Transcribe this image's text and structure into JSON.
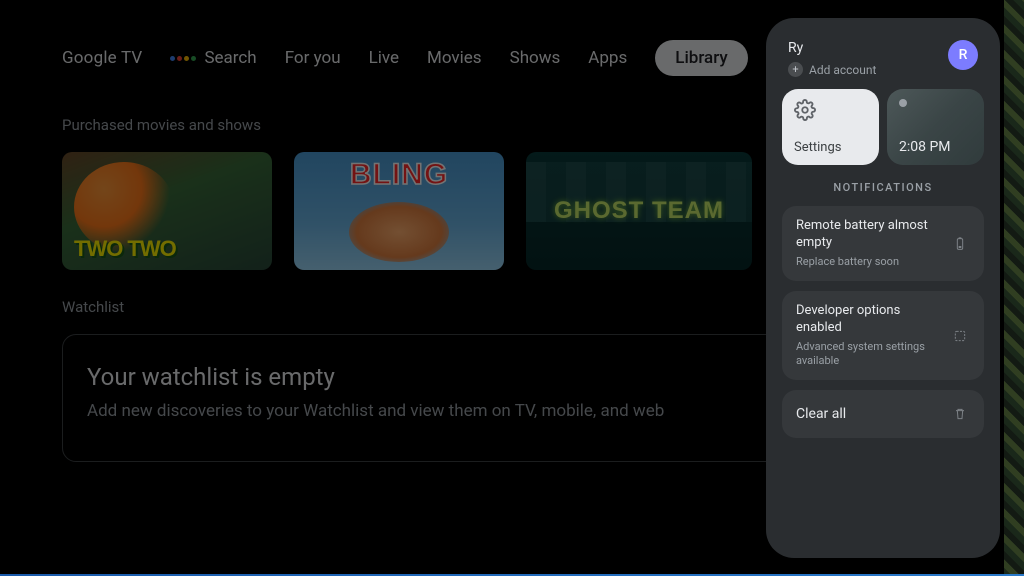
{
  "logo": "Google TV",
  "nav": {
    "search": "Search",
    "foryou": "For you",
    "live": "Live",
    "movies": "Movies",
    "shows": "Shows",
    "apps": "Apps",
    "library": "Library"
  },
  "sections": {
    "purchased": "Purchased movies and shows",
    "watchlist": "Watchlist"
  },
  "posters": {
    "p1": "TWO TWO",
    "p2": "BLING",
    "p3": "GHOST TEAM"
  },
  "watchlist": {
    "title": "Your watchlist is empty",
    "sub": "Add new discoveries to your Watchlist and view them on TV, mobile, and web"
  },
  "panel": {
    "account_name": "Ry",
    "avatar_letter": "R",
    "add_account": "Add account",
    "settings_label": "Settings",
    "clock": "2:08 PM",
    "notifications_header": "NOTIFICATIONS",
    "notif1": {
      "title": "Remote battery almost empty",
      "sub": "Replace battery soon"
    },
    "notif2": {
      "title": "Developer options enabled",
      "sub": "Advanced system settings available"
    },
    "clear_all": "Clear all"
  }
}
